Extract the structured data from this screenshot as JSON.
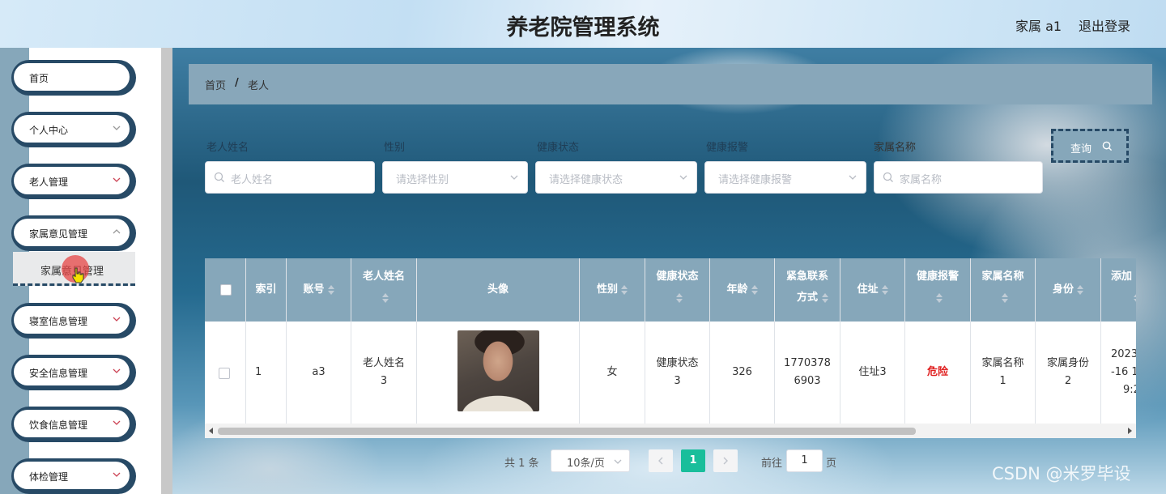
{
  "header": {
    "title": "养老院管理系统",
    "user": "家属 a1",
    "logout": "退出登录"
  },
  "sidebar": {
    "items": [
      {
        "label": "首页",
        "has_arrow": false
      },
      {
        "label": "个人中心",
        "has_arrow": true
      },
      {
        "label": "老人管理",
        "has_arrow": true
      },
      {
        "label": "家属意见管理",
        "has_arrow": true
      },
      {
        "label": "寝室信息管理",
        "has_arrow": true
      },
      {
        "label": "安全信息管理",
        "has_arrow": true
      },
      {
        "label": "饮食信息管理",
        "has_arrow": true
      },
      {
        "label": "体检管理",
        "has_arrow": true
      }
    ],
    "submenu_label": "家属意见管理"
  },
  "breadcrumb": {
    "home": "首页",
    "separator": "/",
    "current": "老人"
  },
  "search": {
    "fields": [
      {
        "label": "老人姓名",
        "placeholder": "老人姓名",
        "type": "input"
      },
      {
        "label": "性别",
        "placeholder": "请选择性别",
        "type": "select"
      },
      {
        "label": "健康状态",
        "placeholder": "请选择健康状态",
        "type": "select"
      },
      {
        "label": "健康报警",
        "placeholder": "请选择健康报警",
        "type": "select"
      },
      {
        "label": "家属名称",
        "placeholder": "家属名称",
        "type": "input"
      }
    ],
    "query_label": "查询"
  },
  "table": {
    "headers": [
      "索引",
      "账号",
      "老人姓名",
      "头像",
      "性别",
      "健康状态",
      "年龄",
      "紧急联系方式",
      "住址",
      "健康报警",
      "家属名称",
      "身份",
      "添加"
    ],
    "rows": [
      {
        "index": "1",
        "account": "a3",
        "name_line1": "老人姓名",
        "name_line2": "3",
        "gender": "女",
        "health_line1": "健康状态",
        "health_line2": "3",
        "age": "326",
        "phone_line1": "1770378",
        "phone_line2": "6903",
        "address": "住址3",
        "alarm": "危险",
        "family_line1": "家属名称",
        "family_line2": "1",
        "identity_line1": "家属身份",
        "identity_line2": "2",
        "added_line1": "2023",
        "added_line2": "-16 1",
        "added_line3": "9:2"
      }
    ]
  },
  "pagination": {
    "total": "共 1 条",
    "page_size": "10条/页",
    "current_page": "1",
    "goto_label": "前往",
    "goto_value": "1",
    "page_suffix": "页"
  },
  "watermark": "CSDN @米罗毕设",
  "colors": {
    "accent": "#86a7ba",
    "dark": "#274a66",
    "page_active": "#19be9b",
    "danger": "#e02020"
  }
}
